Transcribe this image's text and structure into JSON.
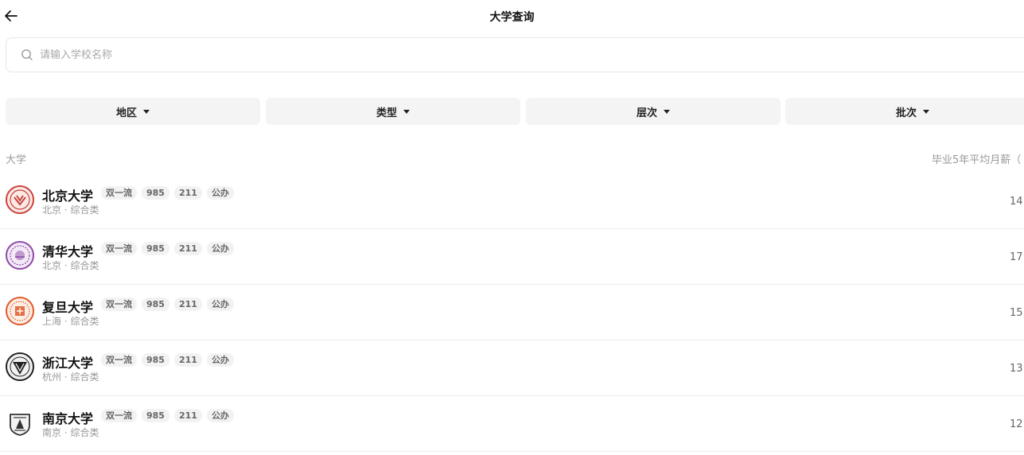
{
  "header": {
    "title": "大学查询"
  },
  "search": {
    "placeholder": "请输入学校名称"
  },
  "filters": [
    {
      "label": "地区"
    },
    {
      "label": "类型"
    },
    {
      "label": "层次"
    },
    {
      "label": "批次"
    }
  ],
  "columns": {
    "left": "大学",
    "right": "毕业5年平均月薪（"
  },
  "universities": [
    {
      "name": "北京大学",
      "tags": [
        "双一流",
        "985",
        "211",
        "公办"
      ],
      "location": "北京",
      "category": "综合类",
      "sub": "北京 · 综合类",
      "salary": "14",
      "logo_color": "#c9423a"
    },
    {
      "name": "清华大学",
      "tags": [
        "双一流",
        "985",
        "211",
        "公办"
      ],
      "location": "北京",
      "category": "综合类",
      "sub": "北京 · 综合类",
      "salary": "17",
      "logo_color": "#8e4aa6"
    },
    {
      "name": "复旦大学",
      "tags": [
        "双一流",
        "985",
        "211",
        "公办"
      ],
      "location": "上海",
      "category": "综合类",
      "sub": "上海 · 综合类",
      "salary": "15",
      "logo_color": "#e0592a"
    },
    {
      "name": "浙江大学",
      "tags": [
        "双一流",
        "985",
        "211",
        "公办"
      ],
      "location": "杭州",
      "category": "综合类",
      "sub": "杭州 · 综合类",
      "salary": "13",
      "logo_color": "#222222"
    },
    {
      "name": "南京大学",
      "tags": [
        "双一流",
        "985",
        "211",
        "公办"
      ],
      "location": "南京",
      "category": "综合类",
      "sub": "南京 · 综合类",
      "salary": "12",
      "logo_color": "#333333"
    }
  ]
}
